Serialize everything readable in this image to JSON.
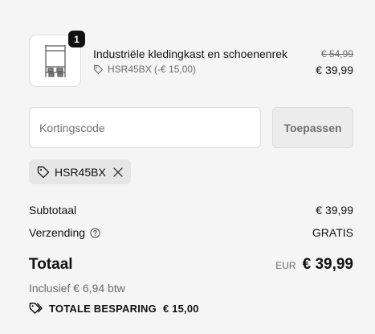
{
  "product": {
    "quantity": "1",
    "name": "Industriële kledingkast en schoenenrek",
    "discount_line": "HSR45BX (-€ 15,00)",
    "original_price": "€ 54,99",
    "price": "€ 39,99",
    "thumbnail_icon": "clothing-rack-icon"
  },
  "discount_form": {
    "placeholder": "Kortingscode",
    "value": "",
    "apply_label": "Toepassen"
  },
  "applied_code": {
    "code": "HSR45BX",
    "tag_icon": "tag-icon",
    "remove_icon": "close-icon"
  },
  "summary": {
    "subtotal_label": "Subtotaal",
    "subtotal_value": "€ 39,99",
    "shipping_label": "Verzending",
    "shipping_value": "GRATIS",
    "total_label": "Totaal",
    "currency": "EUR",
    "total_value": "€ 39,99",
    "tax_note": "Inclusief € 6,94 btw",
    "savings_label": "TOTALE BESPARING",
    "savings_value": "€ 15,00"
  },
  "colors": {
    "background": "#f5f5f5",
    "text": "#111111",
    "muted": "#6b6b6b"
  }
}
